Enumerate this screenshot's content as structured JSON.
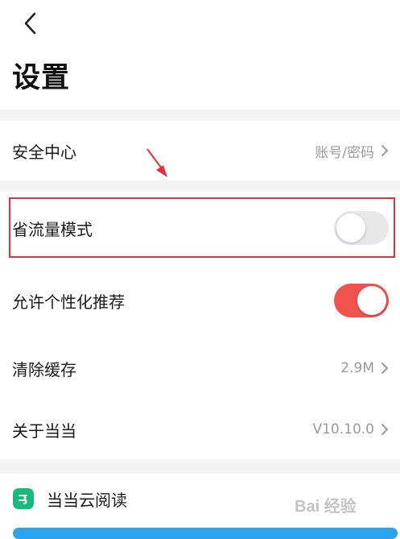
{
  "header": {
    "title": "设置"
  },
  "settings": {
    "security": {
      "label": "安全中心",
      "value": "账号/密码"
    },
    "data_saver": {
      "label": "省流量模式",
      "enabled": false
    },
    "personalized": {
      "label": "允许个性化推荐",
      "enabled": true
    },
    "cache": {
      "label": "清除缓存",
      "value": "2.9M"
    },
    "about": {
      "label": "关于当当",
      "value": "V10.10.0"
    }
  },
  "brand": {
    "name": "当当云阅读"
  },
  "watermark": {
    "text": "Bai 经验"
  },
  "colors": {
    "toggle_on": "#f0524e",
    "toggle_off": "#e8e8e8",
    "highlight_border": "#e2313d",
    "annotation_arrow": "#e2313d",
    "brand_green": "#1ab87a",
    "accent_blue": "#2aa4ef"
  },
  "icons": [
    "back-icon",
    "chevron-right-icon",
    "annotation-arrow-icon",
    "dangdang-logo-icon",
    "baidu-watermark-icon"
  ]
}
